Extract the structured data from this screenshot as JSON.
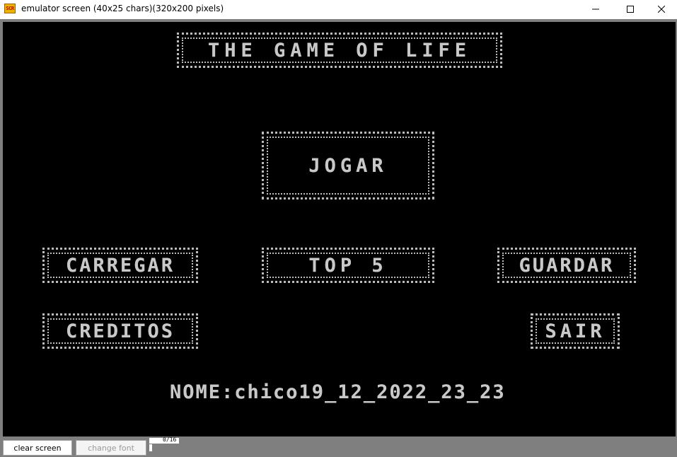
{
  "window": {
    "icon_text": "SCR",
    "title": "emulator screen (40x25 chars)(320x200 pixels)"
  },
  "screen": {
    "title": "THE GAME OF LIFE",
    "menu": {
      "jogar": "JOGAR",
      "carregar": "CARREGAR",
      "top5": "TOP 5",
      "guardar": "GUARDAR",
      "creditos": "CREDITOS",
      "sair": "SAIR"
    },
    "name_line": "NOME:chico19_12_2022_23_23"
  },
  "toolbar": {
    "clear_label": "clear screen",
    "font_label": "change font",
    "counter": "0/16"
  },
  "colors": {
    "screen_bg": "#000000",
    "text": "#c8c8c8",
    "frame": "#7f7f7f"
  }
}
